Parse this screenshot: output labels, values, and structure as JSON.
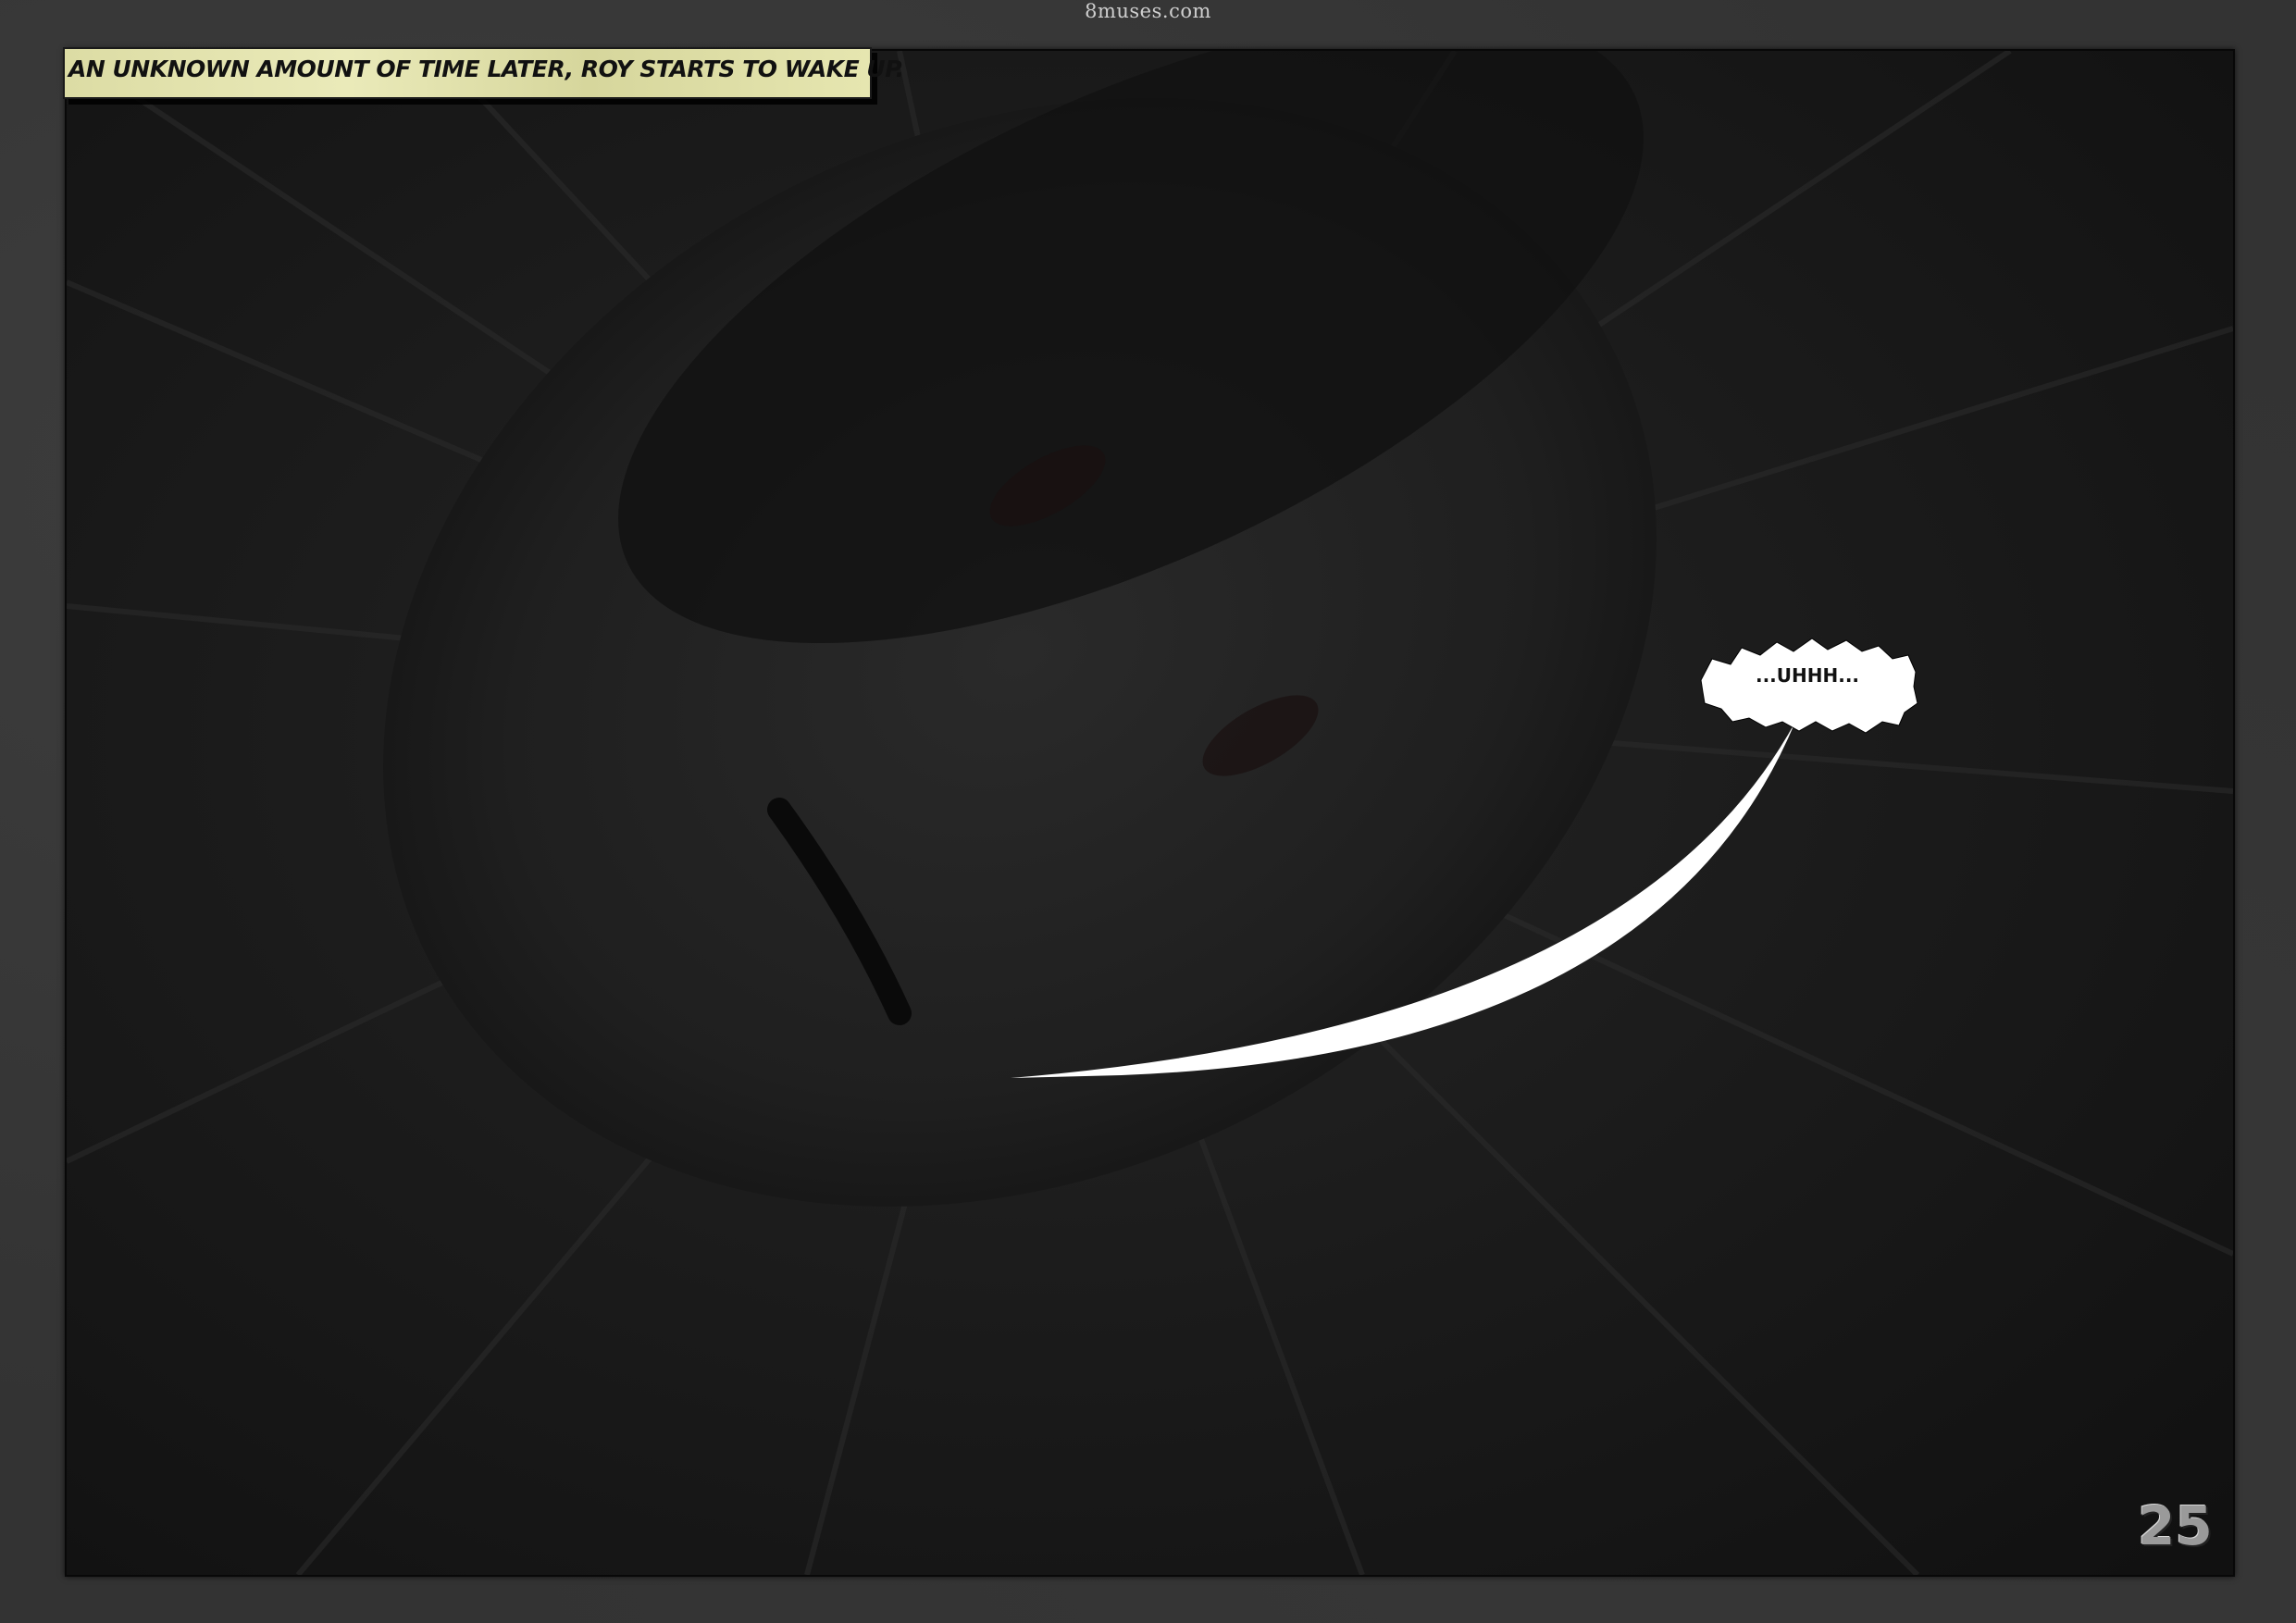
{
  "watermark": "8muses.com",
  "caption": "An unknown amount of time later, Roy starts to wake up.",
  "speech_bubble": "...UHHH...",
  "page_number": "25",
  "colors": {
    "page_background": "#333333",
    "panel_background": "#151515",
    "caption_background": "#e6e6b0",
    "bubble_fill": "#ffffff"
  }
}
